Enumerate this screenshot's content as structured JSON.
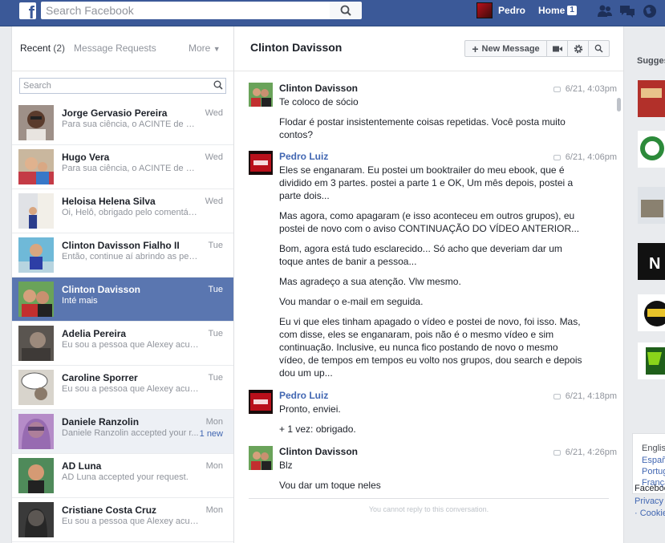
{
  "topbar": {
    "logo": "f",
    "search_placeholder": "Search Facebook",
    "user_name": "Pedro",
    "home_label": "Home",
    "home_count": "1",
    "icons": [
      "friend-requests-icon",
      "messages-icon",
      "globe-notifications-icon"
    ]
  },
  "sidebar": {
    "tab_recent": "Recent",
    "tab_recent_count": "(2)",
    "tab_requests": "Message Requests",
    "tab_more": "More",
    "search_placeholder": "Search",
    "threads": [
      {
        "name": "Jorge Gervasio Pereira",
        "snippet": "Para sua ciência, o ACINTE de Cl...",
        "day": "Wed"
      },
      {
        "name": "Hugo Vera",
        "snippet": "Para sua ciência, o ACINTE de Cl...",
        "day": "Wed"
      },
      {
        "name": "Heloisa Helena Silva",
        "snippet": "Oi, Helô, obrigado pelo comentári...",
        "day": "Wed"
      },
      {
        "name": "Clinton Davisson Fialho II",
        "snippet": "Então, continue aí abrindo as pern...",
        "day": "Tue"
      },
      {
        "name": "Clinton Davisson",
        "snippet": "Inté mais",
        "day": "Tue"
      },
      {
        "name": "Adelia Pereira",
        "snippet": "Eu sou a pessoa que Alexey acus...",
        "day": "Tue"
      },
      {
        "name": "Caroline Sporrer",
        "snippet": "Eu sou a pessoa que Alexey acus...",
        "day": "Tue"
      },
      {
        "name": "Daniele Ranzolin",
        "snippet": "Daniele Ranzolin accepted your r...",
        "day": "Mon",
        "new": "1 new"
      },
      {
        "name": "AD Luna",
        "snippet": "AD Luna accepted your request.",
        "day": "Mon"
      },
      {
        "name": "Cristiane Costa Cruz",
        "snippet": "Eu sou a pessoa que Alexey acus...",
        "day": "Mon"
      }
    ]
  },
  "conversation": {
    "title": "Clinton Davisson",
    "new_message_label": "New Message",
    "groups": [
      {
        "sender": "Clinton Davisson",
        "time": "6/21, 4:03pm",
        "messages": [
          "Te coloco de sócio",
          "Flodar é postar insistentemente coisas repetidas. Você posta muito contos?"
        ]
      },
      {
        "sender": "Pedro Luiz",
        "time": "6/21, 4:06pm",
        "messages": [
          "Eles se enganaram. Eu postei um booktrailer do meu ebook, que é dividido em 3 partes. postei a parte 1 e OK, Um mês depois, postei a parte dois...",
          "Mas agora, como apagaram (e isso aconteceu em outros grupos), eu postei de novo com o aviso CONTINUAÇÃO DO VÍDEO ANTERIOR...",
          "Bom, agora está tudo esclarecido... Só acho que deveriam dar um toque antes de banir a pessoa...",
          "Mas agradeço a sua atenção. Vlw mesmo.",
          "Vou mandar o e-mail em seguida.",
          "Eu vi que eles tinham apagado o vídeo e postei de novo, foi isso. Mas, com disse, eles se enganaram, pois não é o mesmo vídeo e sim continuação. Inclusive, eu nunca fico postando de novo o mesmo vídeo, de tempos em tempos eu volto nos grupos, dou search e depois dou um up..."
        ]
      },
      {
        "sender": "Pedro Luiz",
        "time": "6/21, 4:18pm",
        "messages": [
          "Pronto, enviei.",
          "+ 1 vez: obrigado."
        ]
      },
      {
        "sender": "Clinton Davisson",
        "time": "6/21, 4:26pm",
        "messages": [
          "Blz",
          "Vou dar um toque neles"
        ]
      }
    ],
    "no_reply": "You cannot reply to this conversation."
  },
  "right": {
    "suggested": "Sugges",
    "languages": [
      "English",
      "Españ",
      "Portug",
      "França"
    ],
    "footer": [
      "Faceboo",
      "Privacy",
      "· Cookie"
    ]
  },
  "colors": {
    "brand": "#3b5998",
    "selected_thread": "#5a76b0",
    "link_blue": "#4267b2"
  }
}
